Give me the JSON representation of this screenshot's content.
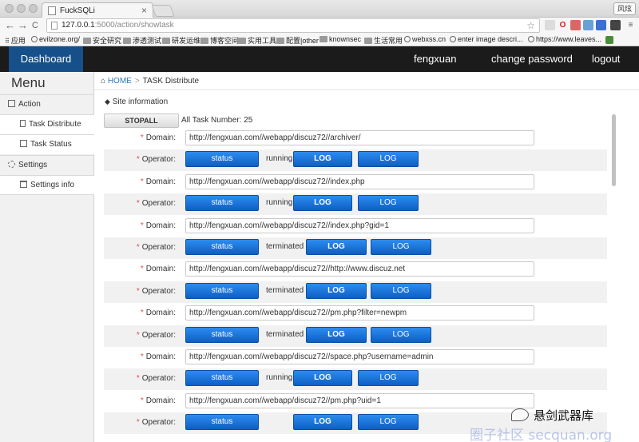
{
  "browser": {
    "tab_title": "FuckSQLi",
    "tab_close": "×",
    "url_host": "127.0.0.1",
    "url_path": ":5000/action/showtask",
    "profile": "风炫",
    "back": "←",
    "forward": "→",
    "reload": "C",
    "star": "☆",
    "bookmarks": [
      "应用",
      "evilzone.org/",
      "安全研究",
      "渗透测试",
      "研发运维",
      "博客空间",
      "实用工具",
      "配置|other",
      "knownsec",
      "生活常用",
      "webxss.cn",
      "enter image descri...",
      "https://www.leaves..."
    ]
  },
  "navbar": {
    "brand": "Dashboard",
    "user": "fengxuan",
    "change_password": "change password",
    "logout": "logout"
  },
  "sidebar": {
    "title": "Menu",
    "items": [
      {
        "label": "Action",
        "icon": "action-icon"
      },
      {
        "label": "Task Distribute",
        "icon": "document-icon"
      },
      {
        "label": "Task Status",
        "icon": "list-icon"
      },
      {
        "label": "Settings",
        "icon": "gear-icon"
      },
      {
        "label": "Settings info",
        "icon": "trash-icon"
      }
    ]
  },
  "breadcrumb": {
    "home_icon": "home-icon",
    "home": "HOME",
    "separator": ">",
    "current": "TASK Distribute"
  },
  "site_info": "Site information",
  "stopall": "STOPALL",
  "task_number": "All Task Number: 25",
  "labels": {
    "domain": "Domain:",
    "operator": "Operator:",
    "required_mark": "*",
    "status_button": "status",
    "log_button": "LOG"
  },
  "tasks": [
    {
      "domain": "http://fengxuan.com//webapp/discuz72//archiver/",
      "state": "running"
    },
    {
      "domain": "http://fengxuan.com//webapp/discuz72//index.php",
      "state": "running"
    },
    {
      "domain": "http://fengxuan.com//webapp/discuz72//index.php?gid=1",
      "state": "terminated"
    },
    {
      "domain": "http://fengxuan.com//webapp/discuz72//http://www.discuz.net",
      "state": "terminated"
    },
    {
      "domain": "http://fengxuan.com//webapp/discuz72//pm.php?filter=newpm",
      "state": "terminated"
    },
    {
      "domain": "http://fengxuan.com//webapp/discuz72//space.php?username=admin",
      "state": "running"
    },
    {
      "domain": "http://fengxuan.com//webapp/discuz72//pm.php?uid=1",
      "state": ""
    }
  ],
  "watermark": {
    "line1": "悬剑武器库",
    "line2": "圈子社区 secquan.org"
  },
  "colors": {
    "navbar_bg": "#1b1b1b",
    "brand_bg": "#16508a",
    "button_blue": "#0e5fc4",
    "link_blue": "#2a79c7",
    "required_red": "#d9534f"
  }
}
